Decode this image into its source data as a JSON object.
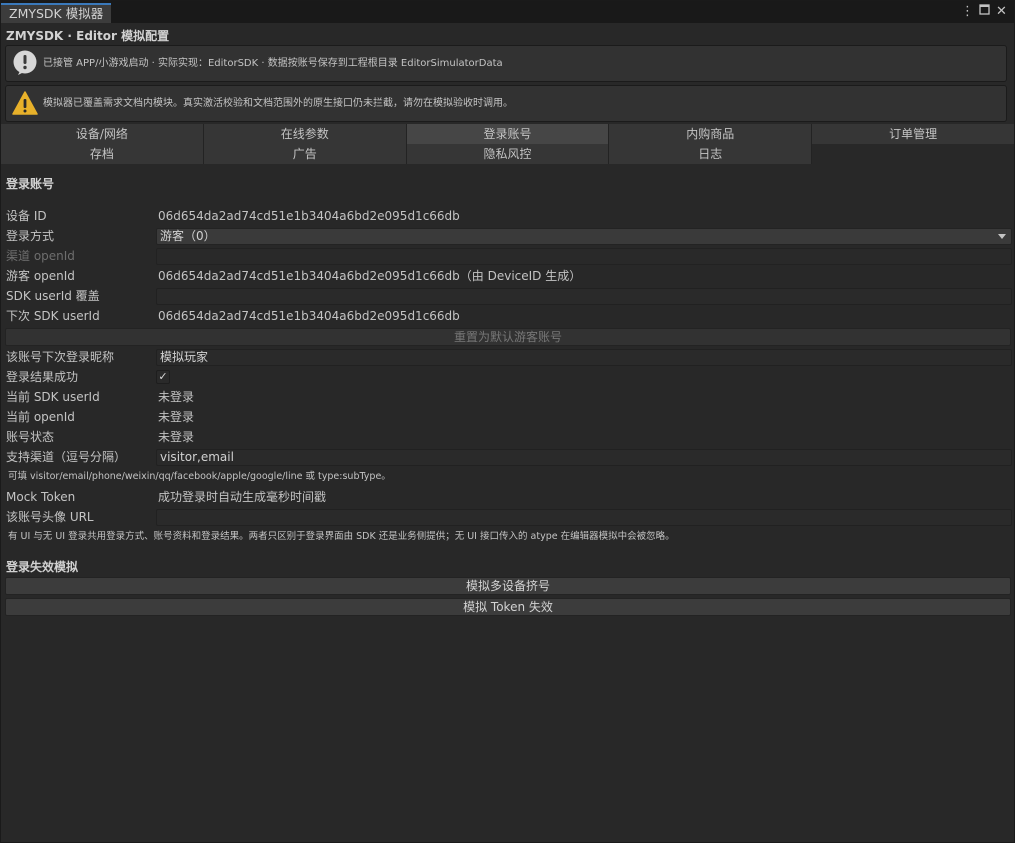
{
  "window": {
    "tab_title": "ZMYSDK 模拟器",
    "header": "ZMYSDK · Editor 模拟配置"
  },
  "help": {
    "info": "已接管 APP/小游戏启动 · 实际实现：EditorSDK · 数据按账号保存到工程根目录 EditorSimulatorData",
    "warning": "模拟器已覆盖需求文档内模块。真实激活校验和文档范围外的原生接口仍未拦截，请勿在模拟验收时调用。"
  },
  "tabs": {
    "row1": [
      "设备/网络",
      "在线参数",
      "登录账号",
      "内购商品",
      "订单管理"
    ],
    "row2": [
      "存档",
      "广告",
      "隐私风控",
      "日志"
    ],
    "selected": "登录账号"
  },
  "login": {
    "section_title": "登录账号",
    "device_id_label": "设备 ID",
    "device_id": "06d654da2ad74cd51e1b3404a6bd2e095d1c66db",
    "login_method_label": "登录方式",
    "login_method": "游客（0）",
    "channel_openid_label": "渠道 openId",
    "channel_openid": "",
    "guest_openid_label": "游客 openId",
    "guest_openid": "06d654da2ad74cd51e1b3404a6bd2e095d1c66db（由 DeviceID 生成）",
    "sdk_userid_override_label": "SDK userId 覆盖",
    "sdk_userid_override": "",
    "next_userid_label": "下次 SDK userId",
    "next_userid": "06d654da2ad74cd51e1b3404a6bd2e095d1c66db",
    "reset_button": "重置为默认游客账号",
    "nickname_label": "该账号下次登录昵称",
    "nickname": "模拟玩家",
    "login_success_label": "登录结果成功",
    "login_success_checked": true,
    "current_userid_label": "当前 SDK userId",
    "current_userid": "未登录",
    "current_openid_label": "当前 openId",
    "current_openid": "未登录",
    "account_status_label": "账号状态",
    "account_status": "未登录",
    "channels_label": "支持渠道（逗号分隔）",
    "channels": "visitor,email",
    "channels_hint": "可填 visitor/email/phone/weixin/qq/facebook/apple/google/line 或 type:subType。",
    "mock_token_label": "Mock Token",
    "mock_token": "成功登录时自动生成毫秒时间戳",
    "avatar_url_label": "该账号头像 URL",
    "avatar_url": "",
    "bottom_note": "有 UI 与无 UI 登录共用登录方式、账号资料和登录结果。两者只区别于登录界面由 SDK 还是业务侧提供；无 UI 接口传入的 atype 在编辑器模拟中会被忽略。"
  },
  "failure": {
    "section_title": "登录失效模拟",
    "multi_device_button": "模拟多设备挤号",
    "token_invalid_button": "模拟 Token 失效"
  },
  "icons": {
    "menu": "kebab-menu-icon",
    "maximize": "maximize-icon",
    "close": "close-icon",
    "info": "info-icon",
    "warning": "warning-icon"
  }
}
